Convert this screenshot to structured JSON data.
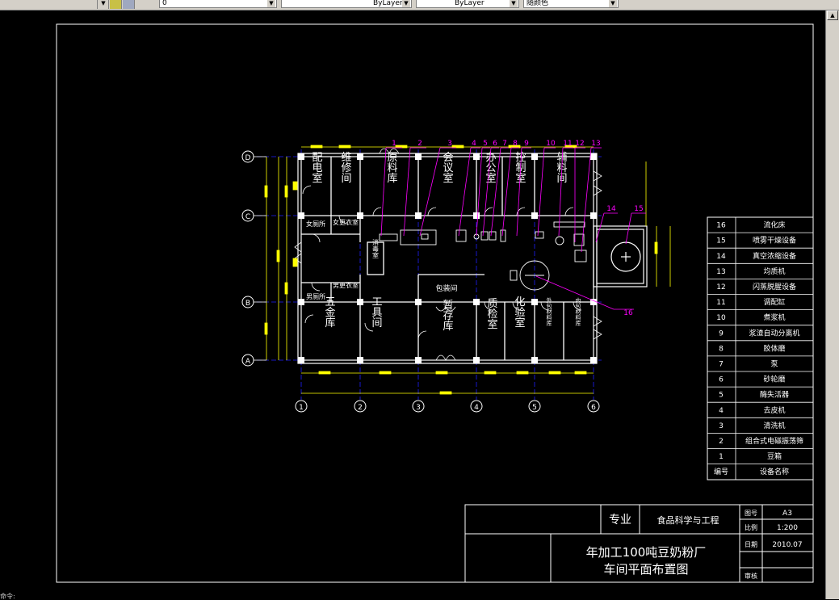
{
  "toolbar": {
    "layer_value": "0",
    "linetype_value": "ByLayer",
    "lineweight_value": "ByLayer",
    "color_value": "随颜色"
  },
  "drawing": {
    "grid_rows": [
      "D",
      "C",
      "B",
      "A"
    ],
    "grid_cols": [
      "1",
      "2",
      "3",
      "4",
      "5",
      "6"
    ],
    "rooms": [
      {
        "label": "配电室"
      },
      {
        "label": "维修间"
      },
      {
        "label": "原料库"
      },
      {
        "label": "会议室"
      },
      {
        "label": "办公室"
      },
      {
        "label": "控制室"
      },
      {
        "label": "辅料间"
      },
      {
        "label": "女厕所"
      },
      {
        "label": "女更衣室"
      },
      {
        "label": "男厕所"
      },
      {
        "label": "男更衣室"
      },
      {
        "label": "消毒室"
      },
      {
        "label": "包装间"
      },
      {
        "label": "五金库"
      },
      {
        "label": "工具间"
      },
      {
        "label": "暂存库"
      },
      {
        "label": "质检室"
      },
      {
        "label": "化验室"
      },
      {
        "label": "外包材料库"
      },
      {
        "label": "内包材料库"
      }
    ],
    "callouts": [
      "1",
      "2",
      "3",
      "4",
      "5",
      "6",
      "7",
      "8",
      "9",
      "10",
      "11",
      "12",
      "13",
      "14",
      "15",
      "16"
    ]
  },
  "equipment_table": {
    "rows": [
      {
        "no": "16",
        "name": "流化床"
      },
      {
        "no": "15",
        "name": "喷雾干燥设备"
      },
      {
        "no": "14",
        "name": "真空浓缩设备"
      },
      {
        "no": "13",
        "name": "均质机"
      },
      {
        "no": "12",
        "name": "闪蒸脱腥设备"
      },
      {
        "no": "11",
        "name": "调配缸"
      },
      {
        "no": "10",
        "name": "煮浆机"
      },
      {
        "no": "9",
        "name": "浆渣自动分离机"
      },
      {
        "no": "8",
        "name": "胶体磨"
      },
      {
        "no": "7",
        "name": "泵"
      },
      {
        "no": "6",
        "name": "砂轮磨"
      },
      {
        "no": "5",
        "name": "酶失活器"
      },
      {
        "no": "4",
        "name": "去皮机"
      },
      {
        "no": "3",
        "name": "清洗机"
      },
      {
        "no": "2",
        "name": "组合式电磁振荡筛"
      },
      {
        "no": "1",
        "name": "豆箱"
      }
    ],
    "header": {
      "no": "编号",
      "name": "设备名称"
    }
  },
  "title_block": {
    "major_label": "专业",
    "major_value": "食品科学与工程",
    "drawing_no_label": "图号",
    "drawing_no_value": "A3",
    "scale_label": "比例",
    "scale_value": "1:200",
    "date_label": "日期",
    "date_value": "2010.07",
    "review_label": "审核",
    "title_line1": "年加工100吨豆奶粉厂",
    "title_line2": "车间平面布置图"
  },
  "cmdline": {
    "text": "命令:"
  },
  "colors": {
    "wall": "#ffffff",
    "dimension": "#ffff00",
    "callout": "#ff00ff",
    "equipment": "#ffffff",
    "axis_line": "#0000ff"
  }
}
